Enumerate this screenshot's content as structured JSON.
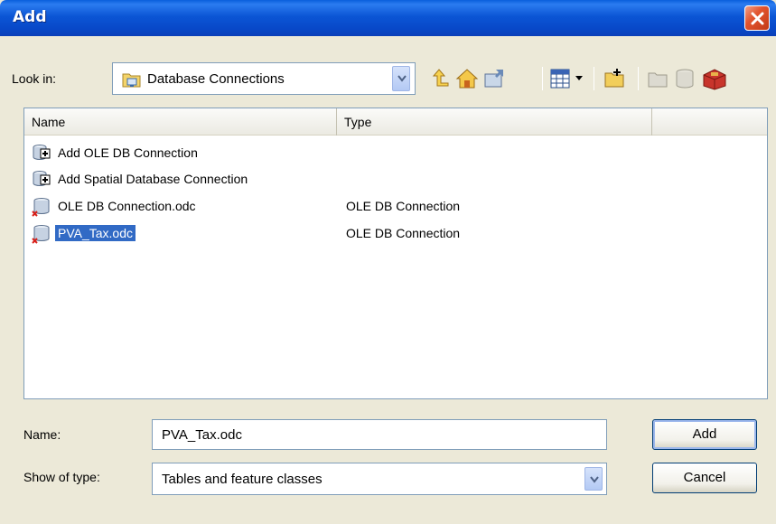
{
  "window": {
    "title": "Add"
  },
  "lookin": {
    "label": "Look in:",
    "value": "Database Connections"
  },
  "toolbar": {
    "icons": [
      "up-one-level-icon",
      "home-icon",
      "connect-folder-icon",
      "view-list-icon",
      "new-folder-icon",
      "folder-icon",
      "database-icon",
      "toolbox-icon"
    ]
  },
  "listview": {
    "columns": [
      "Name",
      "Type"
    ],
    "rows": [
      {
        "name": "Add OLE DB Connection",
        "type": ""
      },
      {
        "name": "Add Spatial Database Connection",
        "type": ""
      },
      {
        "name": "OLE DB Connection.odc",
        "type": "OLE DB Connection"
      },
      {
        "name": "PVA_Tax.odc",
        "type": "OLE DB Connection",
        "selected": true
      }
    ]
  },
  "form": {
    "name_label": "Name:",
    "name_value": "PVA_Tax.odc",
    "type_label": "Show of type:",
    "type_value": "Tables and feature classes"
  },
  "buttons": {
    "add": "Add",
    "cancel": "Cancel"
  },
  "colors": {
    "titlebar": "#0a55d5",
    "selection": "#316ac5",
    "dialog": "#ece9d8"
  }
}
